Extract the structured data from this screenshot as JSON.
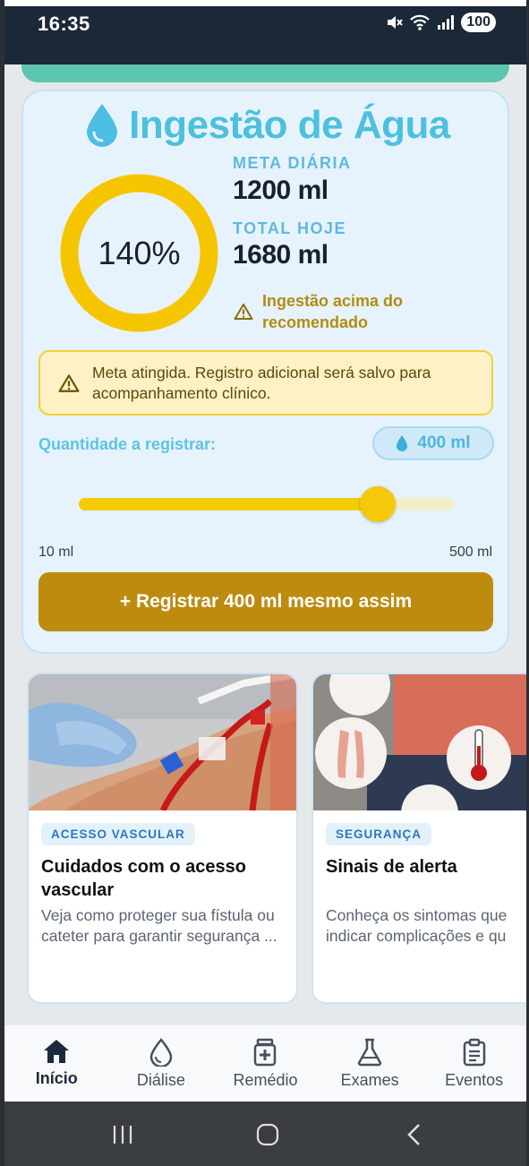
{
  "status_bar": {
    "time": "16:35",
    "battery": "100"
  },
  "water": {
    "title": "Ingestão de Água",
    "percent_text": "140%",
    "progress_fraction": 1.0,
    "daily_goal_label": "META DIÁRIA",
    "daily_goal_value": "1200 ml",
    "today_total_label": "TOTAL HOJE",
    "today_total_value": "1680 ml",
    "above_note": "Ingestão acima do recomendado",
    "alert_text": "Meta atingida. Registro adicional será salvo para acompanhamento clínico.",
    "quantity_label": "Quantidade a registrar:",
    "quantity_value": "400 ml",
    "slider_min_label": "10 ml",
    "slider_max_label": "500 ml",
    "slider_value": 400,
    "slider_min": 10,
    "slider_max": 500,
    "register_button": "+ Registrar 400 ml mesmo assim"
  },
  "colors": {
    "accent_blue": "#4dc0e0",
    "ring_yellow": "#f5c600",
    "warning_text": "#b38b13",
    "button_gold": "#bd8c0f"
  },
  "cards": [
    {
      "tag": "ACESSO VASCULAR",
      "title": "Cuidados com o acesso vascular",
      "description": "Veja como proteger sua fístula ou cateter para garantir segurança ..."
    },
    {
      "tag": "SEGURANÇA",
      "title": "Sinais de alerta",
      "description": "Conheça os sintomas que indicar complicações e qu"
    }
  ],
  "bottom_nav": [
    {
      "label": "Início",
      "icon": "home-icon",
      "active": true
    },
    {
      "label": "Diálise",
      "icon": "drop-outline-icon",
      "active": false
    },
    {
      "label": "Remédio",
      "icon": "medicine-icon",
      "active": false
    },
    {
      "label": "Exames",
      "icon": "flask-icon",
      "active": false
    },
    {
      "label": "Eventos",
      "icon": "clipboard-icon",
      "active": false
    }
  ]
}
